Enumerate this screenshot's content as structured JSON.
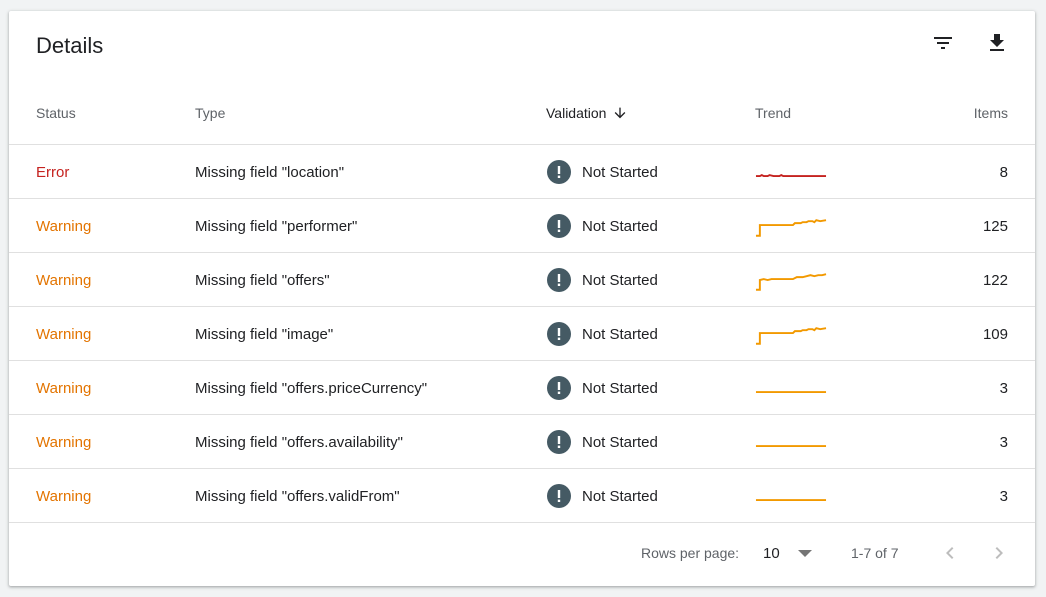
{
  "card": {
    "title": "Details",
    "toolbar": {
      "filter_icon": "filter-icon",
      "download_icon": "download-icon"
    }
  },
  "table": {
    "columns": {
      "status": "Status",
      "type": "Type",
      "validation": "Validation",
      "trend": "Trend",
      "items": "Items"
    },
    "sort_icon": "arrow-down-icon",
    "rows": [
      {
        "status": "Error",
        "type": "Missing field \"location\"",
        "validation": "Not Started",
        "items": "8"
      },
      {
        "status": "Warning",
        "type": "Missing field \"performer\"",
        "validation": "Not Started",
        "items": "125"
      },
      {
        "status": "Warning",
        "type": "Missing field \"offers\"",
        "validation": "Not Started",
        "items": "122"
      },
      {
        "status": "Warning",
        "type": "Missing field \"image\"",
        "validation": "Not Started",
        "items": "109"
      },
      {
        "status": "Warning",
        "type": "Missing field \"offers.priceCurrency\"",
        "validation": "Not Started",
        "items": "3"
      },
      {
        "status": "Warning",
        "type": "Missing field \"offers.availability\"",
        "validation": "Not Started",
        "items": "3"
      },
      {
        "status": "Warning",
        "type": "Missing field \"offers.validFrom\"",
        "validation": "Not Started",
        "items": "3"
      }
    ]
  },
  "footer": {
    "rows_per_page_label": "Rows per page:",
    "rows_per_page_value": "10",
    "range": "1-7 of 7",
    "prev_icon": "chevron-left-icon",
    "next_icon": "chevron-right-icon"
  },
  "colors": {
    "error": "#c5221f",
    "warning": "#e37400",
    "trend_error": "#c5221f",
    "trend_warning": "#f29900",
    "validation_icon": "#455a64"
  }
}
